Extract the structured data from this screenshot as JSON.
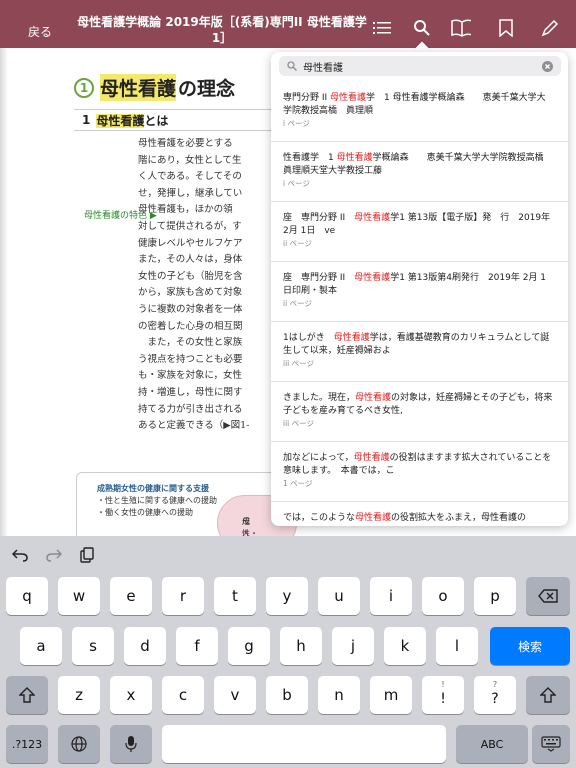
{
  "topbar": {
    "back_label": "戻る",
    "title": "母性看護学概論 2019年版［(系看)専門II 母性看護学1］",
    "icons": [
      "list-icon",
      "search-icon",
      "book-icon",
      "bookmark-icon",
      "pencil-icon"
    ]
  },
  "book": {
    "section_number": "1",
    "section_title_hl": "母性看護",
    "section_title_rest": "の理念",
    "sub_number": "1",
    "sub_title_hl": "母性看護",
    "sub_title_rest": "とは",
    "body_lines": [
      "母性看護を必要とする",
      "階にあり，女性として生",
      "く人である。そしてその",
      "せ，発揮し，継承してい",
      "母性看護も，ほかの領",
      "対して提供されるが，す",
      "健康レベルやセルフケア",
      "また，その人々は，身体",
      "女性の子ども（胎児を含",
      "から，家族も含めて対象",
      "うに複数の対象者を一体",
      "の密着した心身の相互関",
      "　また，その女性と家族",
      "う視点を持つことも必要",
      "も・家族を対象に，女性",
      "持・増進し，母性に関す",
      "持てる力が引き出される",
      "あると定義できる（▶図1-"
    ],
    "margin_label": "母性看護の特色 ▶",
    "figure": {
      "heading": "成熟期女性の健康に関する支援",
      "items": [
        "・性と生殖に関する健康への援助",
        "・働く女性の健康への援助"
      ],
      "blob_text_1": "成人",
      "blob_text_2": "母性・父性"
    }
  },
  "search": {
    "query": "母性看護",
    "placeholder": "検索",
    "results": [
      {
        "pre": "専門分野 II ",
        "hit": "母性看護",
        "post": "学　1 母性看護学概論森　　恵美千葉大学大学院教授高橋　眞理順",
        "page": "i ページ"
      },
      {
        "pre": "性看護学　1 ",
        "hit": "母性看護",
        "post": "学概論森　　恵美千葉大学大学院教授高橋　眞理順天堂大学教授工藤",
        "page": "i ページ"
      },
      {
        "pre": "座　専門分野 II　",
        "hit": "母性看護",
        "post": "学1 第13版【電子版】発　行　2019年 2月 1日　ve",
        "page": "ii ページ"
      },
      {
        "pre": "座　専門分野 II　",
        "hit": "母性看護",
        "post": "学1 第13版第4刷発行　2019年 2月 1日印刷・製本",
        "page": "ii ページ"
      },
      {
        "pre": "1はしがき　",
        "hit": "母性看護",
        "post": "学は，看護基礎教育のカリキュラムとして誕生して以来，妊産褥婦およ",
        "page": "iii ページ"
      },
      {
        "pre": "きました。現在，",
        "hit": "母性看護",
        "post": "の対象は，妊産褥婦とその子ども，将来子どもを産み育てるべき女性,",
        "page": "iii ページ"
      },
      {
        "pre": "加などによって，",
        "hit": "母性看護",
        "post": "の役割はますます拡大されていることを意味します。　本書では，こ",
        "page": "1 ページ"
      },
      {
        "pre": "では，このような",
        "hit": "母性看護",
        "post": "の役割拡大をふまえ，母性看護の",
        "page": ""
      }
    ]
  },
  "keyboard": {
    "row1": [
      "q",
      "w",
      "e",
      "r",
      "t",
      "y",
      "u",
      "i",
      "o",
      "p"
    ],
    "row2": [
      "a",
      "s",
      "d",
      "f",
      "g",
      "h",
      "j",
      "k",
      "l"
    ],
    "row3": [
      "z",
      "x",
      "c",
      "v",
      "b",
      "n",
      "m"
    ],
    "exclaim_sub": "!",
    "exclaim_main": "!",
    "question_sub": "?",
    "question_main": "?",
    "search_label": "検索",
    "numbers_label": ".?123",
    "abc_label": "ABC"
  },
  "colors": {
    "topbar": "#8e4755",
    "highlight": "#f5e96b",
    "hit": "#e02020",
    "search_key": "#007aff"
  }
}
